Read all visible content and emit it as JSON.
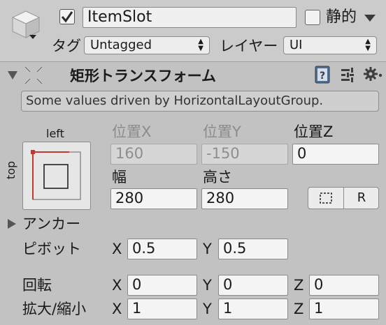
{
  "header": {
    "object_name": "ItemSlot",
    "active_checked": true,
    "static_label": "静的",
    "static_checked": false,
    "tag_label": "タグ",
    "tag_value": "Untagged",
    "layer_label": "レイヤー",
    "layer_value": "UI"
  },
  "component": {
    "title": "矩形トランスフォーム",
    "info_text": "Some values driven by HorizontalLayoutGroup.",
    "anchor_preset": {
      "top_label": "left",
      "side_label": "top"
    },
    "fields": {
      "pos_x_label": "位置X",
      "pos_y_label": "位置Y",
      "pos_z_label": "位置Z",
      "pos_x": "160",
      "pos_y": "-150",
      "pos_z": "0",
      "width_label": "幅",
      "height_label": "高さ",
      "width": "280",
      "height": "280"
    },
    "raw_button_label": "R",
    "anchors_label": "アンカー",
    "pivot": {
      "label": "ピボット",
      "x_axis": "X",
      "x": "0.5",
      "y_axis": "Y",
      "y": "0.5"
    },
    "rotation": {
      "label": "回転",
      "x_axis": "X",
      "x": "0",
      "y_axis": "Y",
      "y": "0",
      "z_axis": "Z",
      "z": "0"
    },
    "scale": {
      "label": "拡大/縮小",
      "x_axis": "X",
      "x": "1",
      "y_axis": "Y",
      "y": "1",
      "z_axis": "Z",
      "z": "1"
    }
  },
  "colors": {
    "header_bg": "#cbcbcb",
    "panel_bg": "#c2c2c2",
    "anchor_red": "#c0392b",
    "checkbox_dark": "#2b2b2b"
  },
  "icons": [
    "gameobject-cube-icon",
    "dropdown-arrow-icon",
    "foldout-arrow-icon",
    "recttransform-icon",
    "help-book-icon",
    "presets-icon",
    "gear-icon",
    "blueprint-mode-icon"
  ]
}
